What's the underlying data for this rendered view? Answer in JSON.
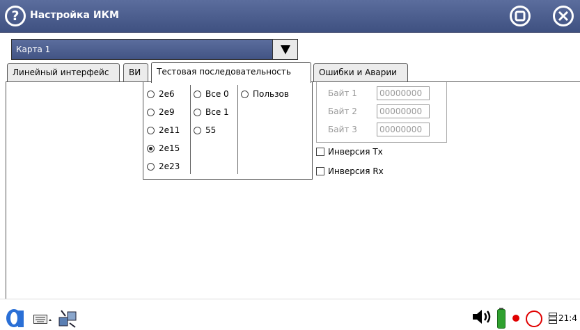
{
  "window": {
    "title": "Настройка ИКМ"
  },
  "card_select": {
    "value": "Карта 1"
  },
  "tabs": [
    {
      "label": "Линейный интерфейс",
      "active": false
    },
    {
      "label": "ВИ",
      "active": false
    },
    {
      "label": "Тестовая последовательность",
      "active": true
    },
    {
      "label": "Ошибки и Аварии",
      "active": false
    }
  ],
  "sequence": {
    "options": [
      {
        "label": "2e6",
        "selected": false
      },
      {
        "label": "2e9",
        "selected": false
      },
      {
        "label": "2e11",
        "selected": false
      },
      {
        "label": "2e15",
        "selected": true
      },
      {
        "label": "2e23",
        "selected": false
      },
      {
        "label": "Все 0",
        "selected": false
      },
      {
        "label": "Все 1",
        "selected": false
      },
      {
        "label": "55",
        "selected": false
      },
      {
        "label": "Пользов",
        "selected": false
      }
    ]
  },
  "bytes": [
    {
      "label": "Байт 1",
      "value": "00000000"
    },
    {
      "label": "Байт 2",
      "value": "00000000"
    },
    {
      "label": "Байт 3",
      "value": "00000000"
    }
  ],
  "checkboxes": {
    "inversion_tx": {
      "label": "Инверсия Тх",
      "checked": false
    },
    "inversion_rx": {
      "label": "Инверсия Rx",
      "checked": false
    }
  },
  "taskbar": {
    "clock": "21:4"
  },
  "colors": {
    "titlebar": "#4a5c8c",
    "battery": "#2fa12f",
    "record": "#e00000"
  },
  "icons": [
    "help-icon",
    "stop-icon",
    "close-icon",
    "dropdown-arrow-icon",
    "app-menu-icon",
    "keyboard-icon",
    "network-icon",
    "speaker-icon",
    "battery-icon",
    "record-icon",
    "power-icon",
    "storage-icon"
  ]
}
